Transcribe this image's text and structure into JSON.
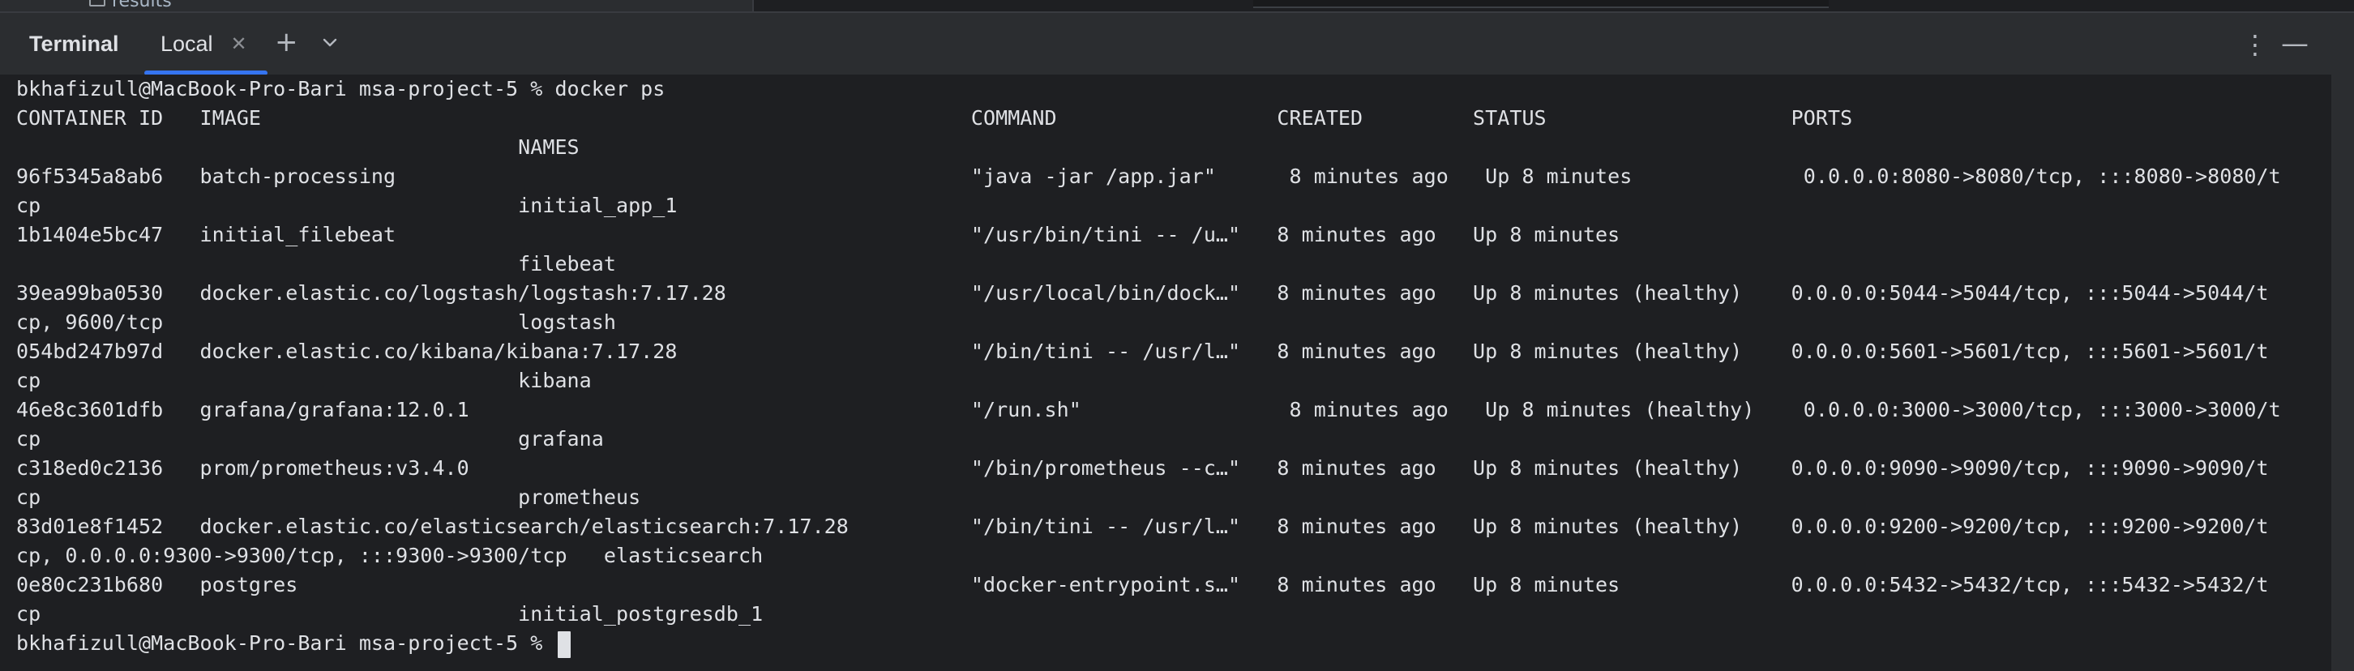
{
  "project_tree": {
    "partial_item": "results"
  },
  "tool_window": {
    "title": "Terminal",
    "active_tab": {
      "label": "Local",
      "close_glyph": "✕"
    },
    "add_tab_glyph": "+",
    "tabs_dropdown_icon": "chevron-down-icon",
    "more_glyph": "⋮",
    "hide_glyph": "—"
  },
  "terminal": {
    "lines": [
      "bkhafizull@MacBook-Pro-Bari msa-project-5 % docker ps",
      "CONTAINER ID   IMAGE                                                          COMMAND                  CREATED         STATUS                    PORTS",
      "                                         NAMES",
      "96f5345a8ab6   batch-processing                                               \"java -jar /app.jar\"      8 minutes ago   Up 8 minutes              0.0.0.0:8080->8080/tcp, :::8080->8080/t",
      "cp                                       initial_app_1",
      "1b1404e5bc47   initial_filebeat                                               \"/usr/bin/tini -- /u…\"   8 minutes ago   Up 8 minutes",
      "                                         filebeat",
      "39ea99ba0530   docker.elastic.co/logstash/logstash:7.17.28                    \"/usr/local/bin/dock…\"   8 minutes ago   Up 8 minutes (healthy)    0.0.0.0:5044->5044/tcp, :::5044->5044/t",
      "cp, 9600/tcp                             logstash",
      "054bd247b97d   docker.elastic.co/kibana/kibana:7.17.28                        \"/bin/tini -- /usr/l…\"   8 minutes ago   Up 8 minutes (healthy)    0.0.0.0:5601->5601/tcp, :::5601->5601/t",
      "cp                                       kibana",
      "46e8c3601dfb   grafana/grafana:12.0.1                                         \"/run.sh\"                 8 minutes ago   Up 8 minutes (healthy)    0.0.0.0:3000->3000/tcp, :::3000->3000/t",
      "cp                                       grafana",
      "c318ed0c2136   prom/prometheus:v3.4.0                                         \"/bin/prometheus --c…\"   8 minutes ago   Up 8 minutes (healthy)    0.0.0.0:9090->9090/tcp, :::9090->9090/t",
      "cp                                       prometheus",
      "83d01e8f1452   docker.elastic.co/elasticsearch/elasticsearch:7.17.28          \"/bin/tini -- /usr/l…\"   8 minutes ago   Up 8 minutes (healthy)    0.0.0.0:9200->9200/tcp, :::9200->9200/t",
      "cp, 0.0.0.0:9300->9300/tcp, :::9300->9300/tcp   elasticsearch",
      "0e80c231b680   postgres                                                       \"docker-entrypoint.s…\"   8 minutes ago   Up 8 minutes              0.0.0.0:5432->5432/tcp, :::5432->5432/t",
      "cp                                       initial_postgresdb_1"
    ],
    "prompt": "bkhafizull@MacBook-Pro-Bari msa-project-5 % "
  },
  "colors": {
    "background": "#1e1f22",
    "header_background": "#2b2d30",
    "text": "#dfe1e5",
    "accent": "#3574f0"
  }
}
